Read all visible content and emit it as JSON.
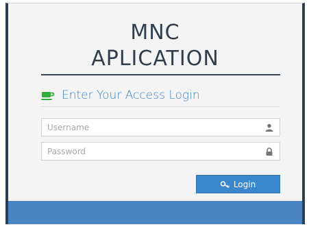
{
  "app": {
    "title_line1": "MNC",
    "title_line2": "APLICATION"
  },
  "login": {
    "subtitle": "Enter Your Access Login",
    "subtitle_icon": "coffee-cup-icon",
    "username": {
      "placeholder": "Username",
      "value": "",
      "icon": "user-icon"
    },
    "password": {
      "placeholder": "Password",
      "value": "",
      "icon": "lock-icon"
    },
    "button_label": "Login",
    "button_icon": "key-icon"
  },
  "colors": {
    "accent": "#3a87cb",
    "subtitle": "#3b83c4",
    "icon_green": "#2fae3a",
    "title": "#2f3d4c",
    "footer": "#4a86c4",
    "border": "#2d3e50"
  }
}
